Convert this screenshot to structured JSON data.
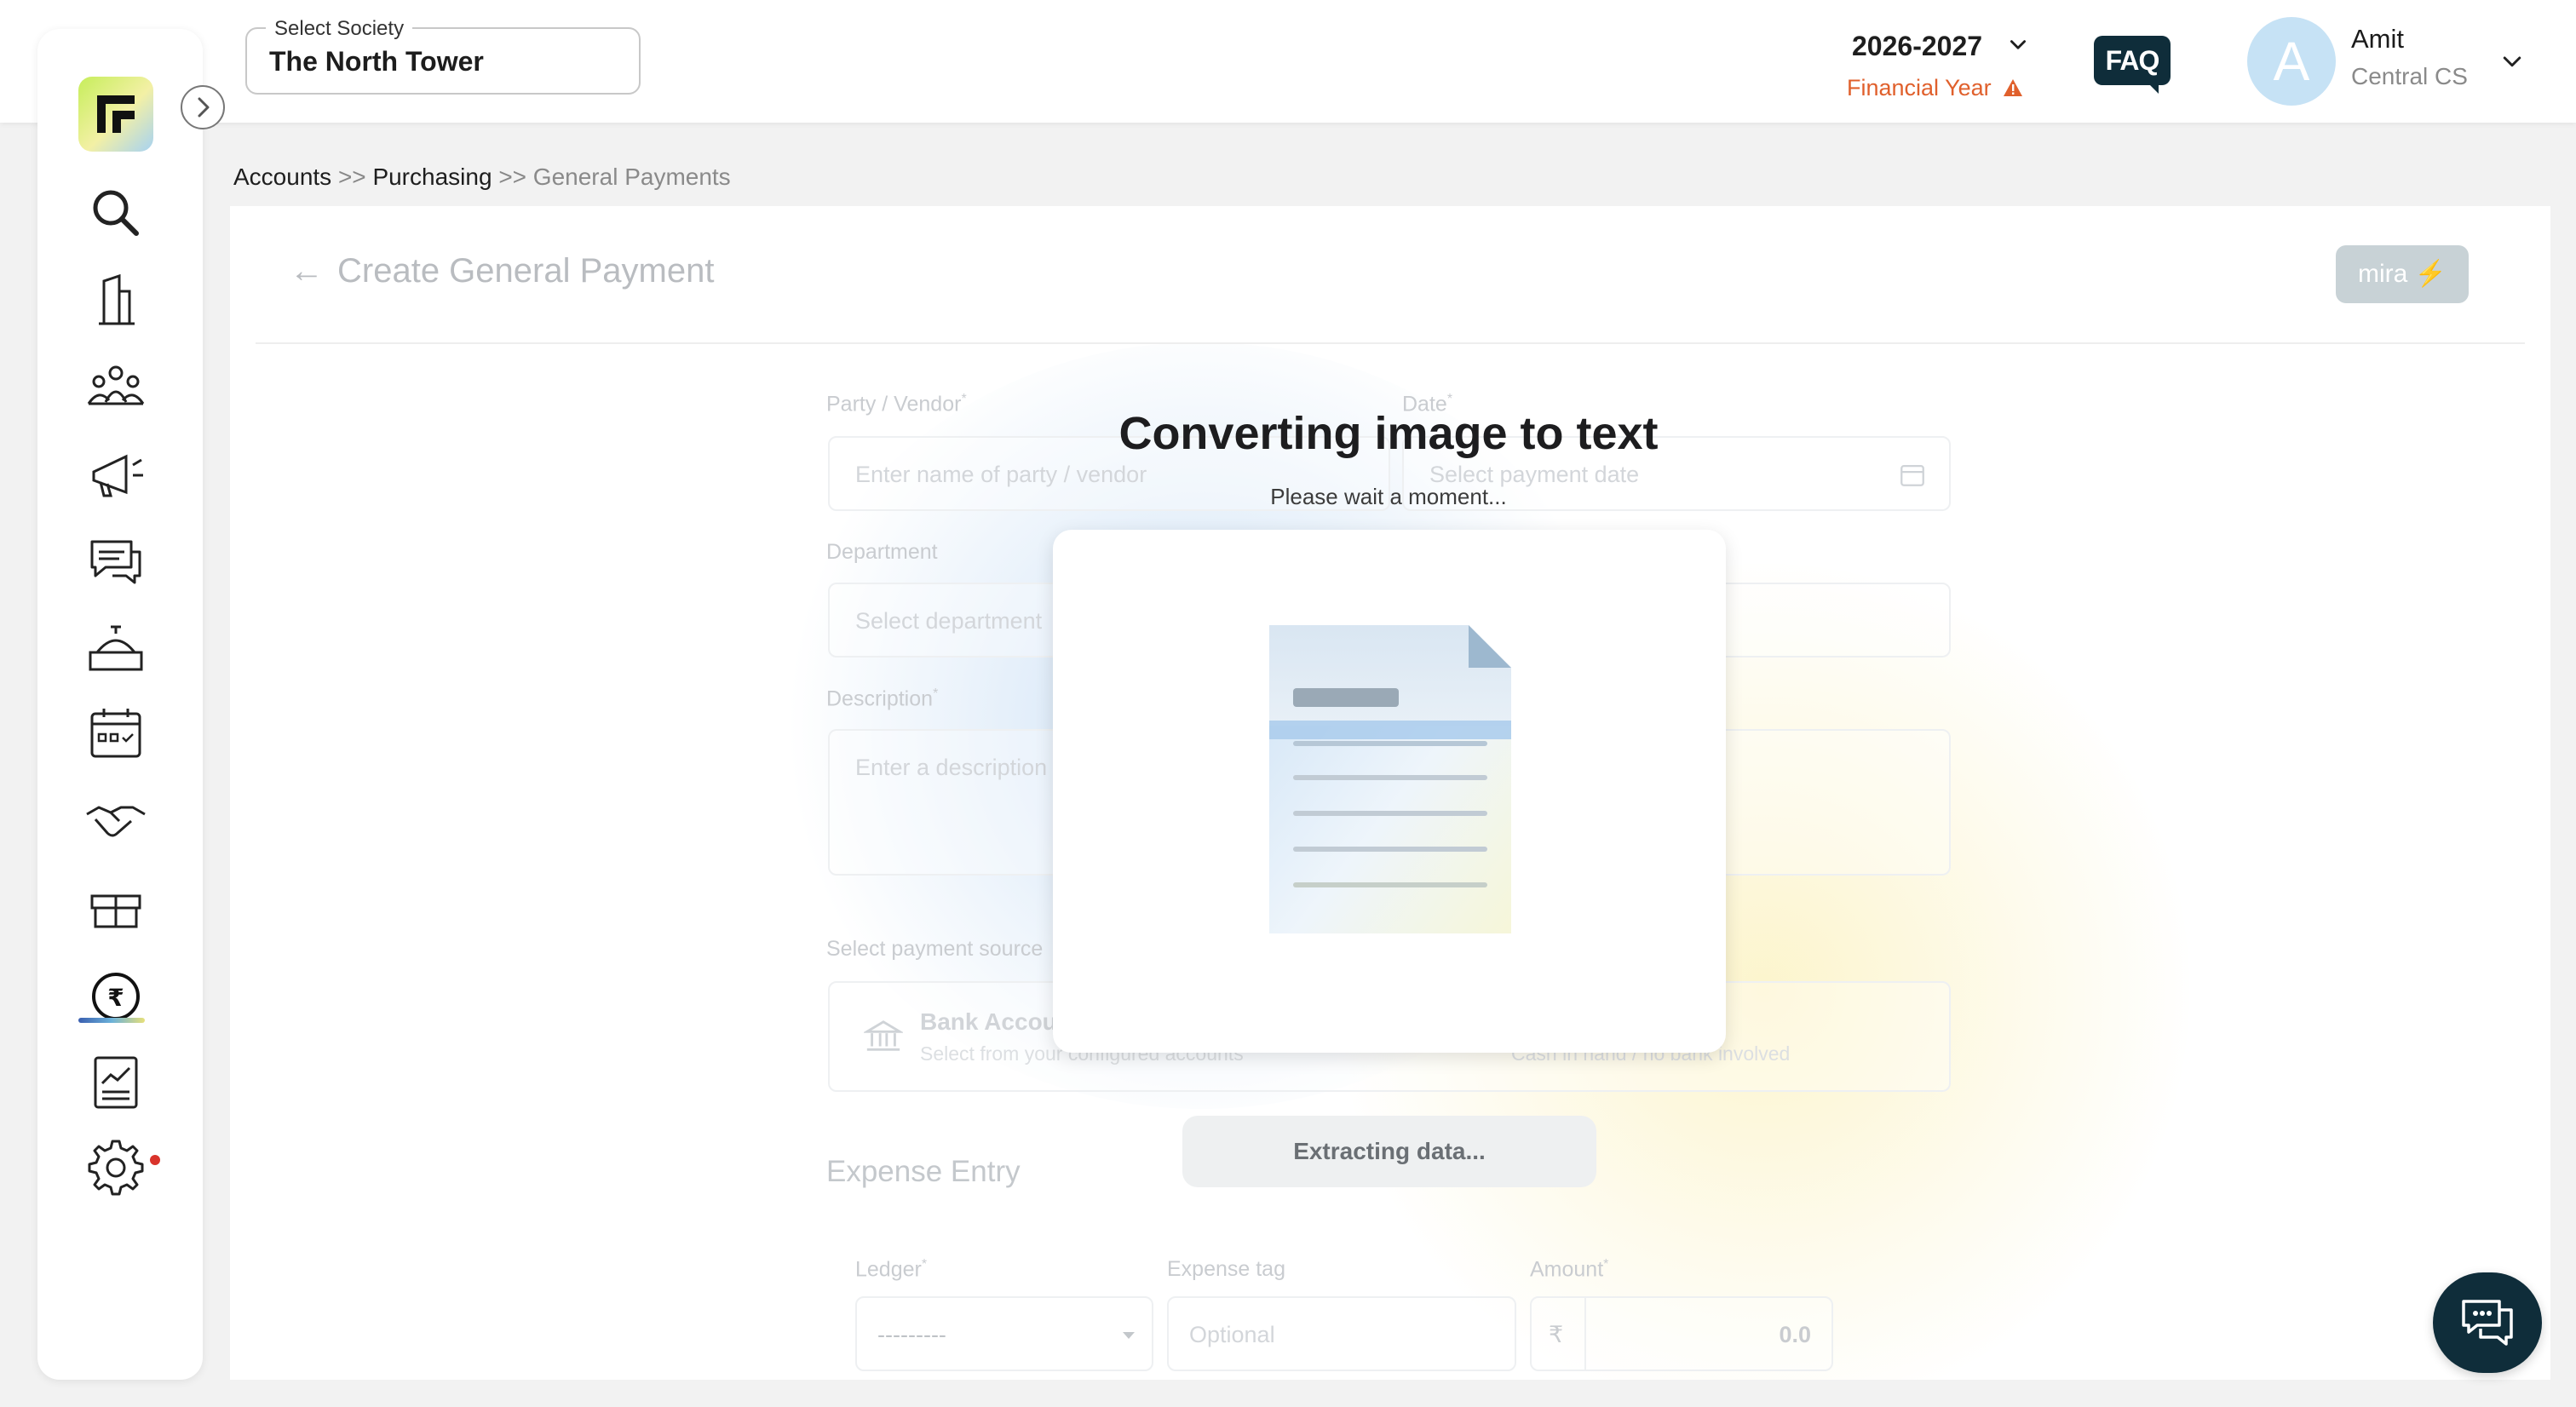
{
  "header": {
    "society_legend": "Select Society",
    "society_value": "The North Tower",
    "financial_year": "2026-2027",
    "financial_year_label": "Financial Year",
    "faq_label": "FAQ",
    "user_initial": "A",
    "user_name": "Amit",
    "user_role": "Central CS"
  },
  "sidebar": {
    "items": [
      {
        "name": "search",
        "icon": "search-icon"
      },
      {
        "name": "building",
        "icon": "building-icon"
      },
      {
        "name": "members",
        "icon": "users-icon"
      },
      {
        "name": "announcements",
        "icon": "megaphone-icon"
      },
      {
        "name": "communication",
        "icon": "chat-icon"
      },
      {
        "name": "helpdesk",
        "icon": "service-bell-icon"
      },
      {
        "name": "calendar",
        "icon": "calendar-icon"
      },
      {
        "name": "partners",
        "icon": "handshake-icon"
      },
      {
        "name": "inventory",
        "icon": "box-icon"
      },
      {
        "name": "accounts",
        "icon": "rupee-icon",
        "active": true
      },
      {
        "name": "reports",
        "icon": "report-icon"
      },
      {
        "name": "settings",
        "icon": "gear-icon",
        "notification": true
      }
    ]
  },
  "breadcrumb": {
    "items": [
      "Accounts",
      "Purchasing",
      "General Payments"
    ],
    "separator": ">>"
  },
  "page": {
    "title": "Create General Payment",
    "back_arrow": "←",
    "mira_label": "mira"
  },
  "form": {
    "party_label": "Party / Vendor",
    "party_placeholder": "Enter name of party / vendor",
    "date_label": "Date",
    "date_placeholder": "Select payment date",
    "department_label": "Department",
    "department_placeholder": "Select department",
    "description_label": "Description",
    "description_placeholder": "Enter a description",
    "payment_source_label": "Select payment source",
    "bank_title": "Bank Account",
    "bank_subtitle": "Select from your configured accounts",
    "cash_subtitle": "Cash in hand / no bank involved",
    "required_mark": "*"
  },
  "expense": {
    "section_title": "Expense Entry",
    "ledger_label": "Ledger",
    "ledger_value": "---------",
    "tag_label": "Expense tag",
    "tag_placeholder": "Optional",
    "amount_label": "Amount",
    "currency_symbol": "₹",
    "amount_value": "0.0"
  },
  "modal": {
    "title": "Converting image to text",
    "subtitle": "Please wait a moment...",
    "status": "Extracting data..."
  },
  "colors": {
    "brand_dark": "#0f2d3a",
    "warning": "#e0602c",
    "avatar_bg": "#c6e2f5"
  }
}
